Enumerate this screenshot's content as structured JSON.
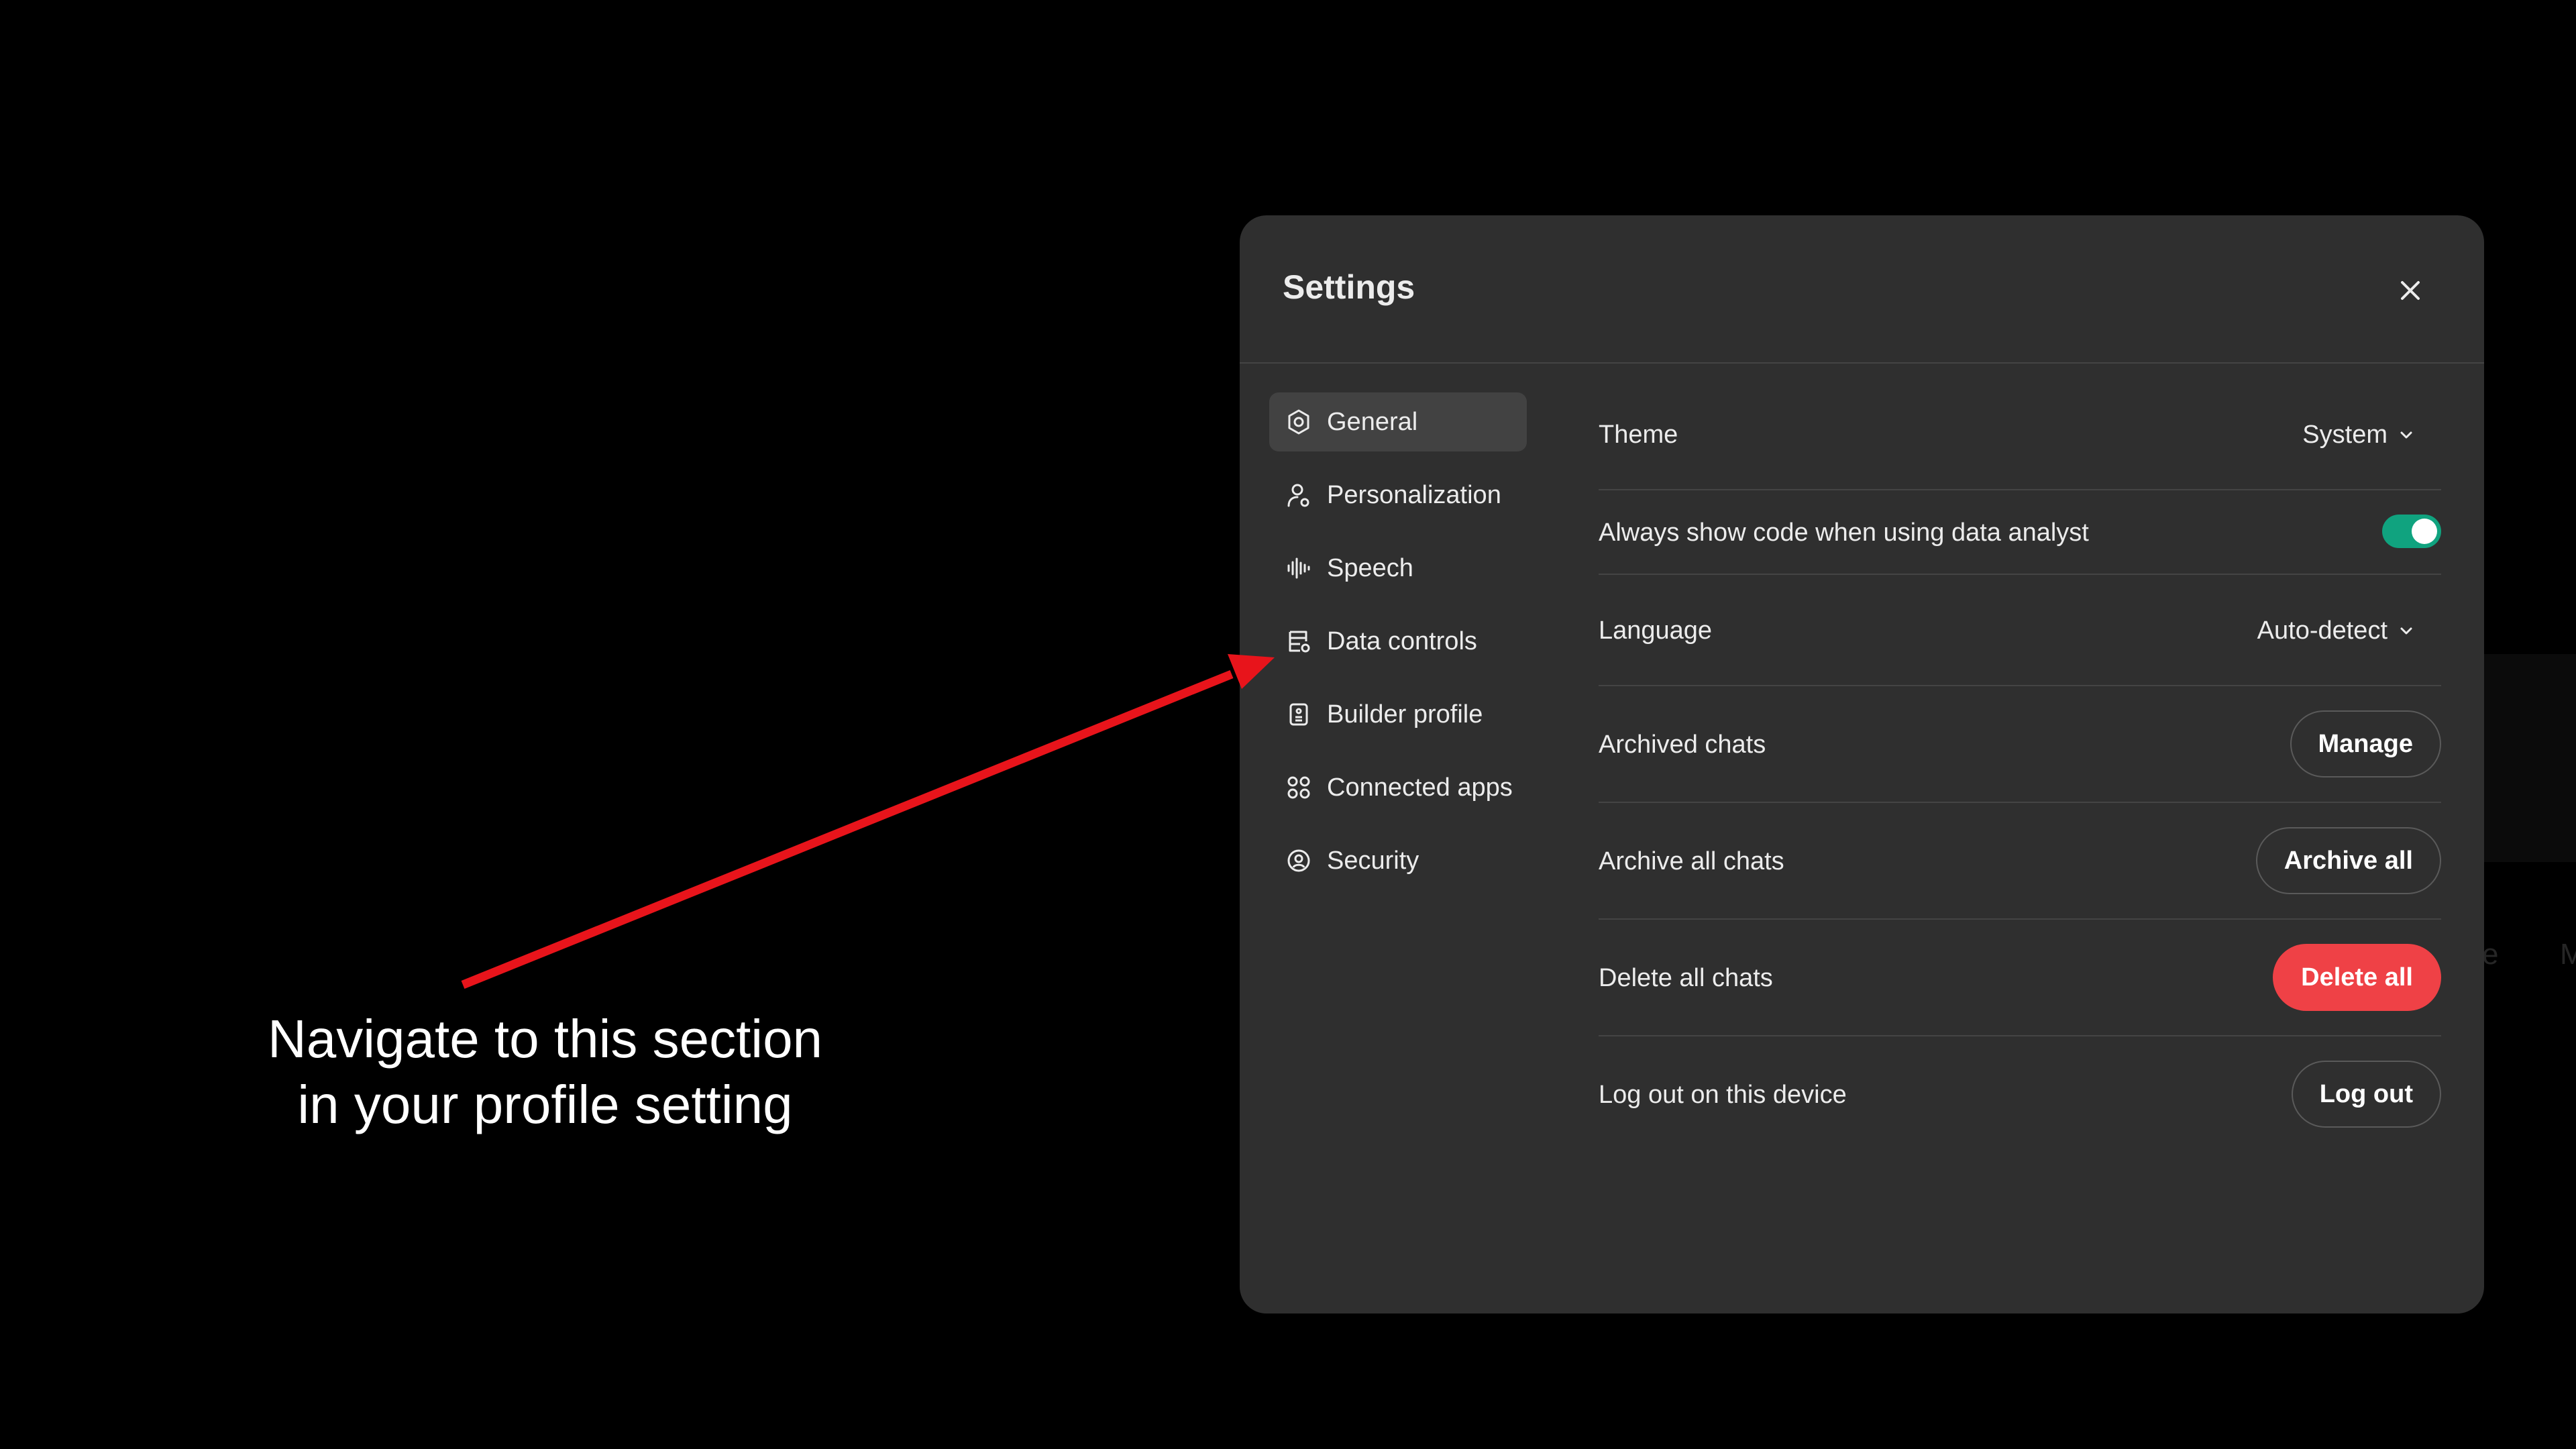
{
  "annotation": {
    "caption_line1": "Navigate to this section",
    "caption_line2": "in your profile setting",
    "arrow_color": "#e8141b"
  },
  "settings": {
    "title": "Settings",
    "close_icon": "close-icon",
    "sidebar": {
      "items": [
        {
          "label": "General",
          "icon": "gear-icon",
          "active": true
        },
        {
          "label": "Personalization",
          "icon": "person-icon",
          "active": false
        },
        {
          "label": "Speech",
          "icon": "soundwave-icon",
          "active": false
        },
        {
          "label": "Data controls",
          "icon": "database-icon",
          "active": false
        },
        {
          "label": "Builder profile",
          "icon": "id-badge-icon",
          "active": false
        },
        {
          "label": "Connected apps",
          "icon": "apps-grid-icon",
          "active": false
        },
        {
          "label": "Security",
          "icon": "shield-icon",
          "active": false
        }
      ]
    },
    "general": {
      "theme": {
        "label": "Theme",
        "value": "System"
      },
      "show_code": {
        "label": "Always show code when using data analyst",
        "enabled": true
      },
      "language": {
        "label": "Language",
        "value": "Auto-detect"
      },
      "archived_chats": {
        "label": "Archived chats",
        "button": "Manage"
      },
      "archive_all": {
        "label": "Archive all chats",
        "button": "Archive all"
      },
      "delete_all": {
        "label": "Delete all chats",
        "button": "Delete all"
      },
      "log_out": {
        "label": "Log out on this device",
        "button": "Log out"
      }
    }
  },
  "colors": {
    "page_bg": "#000000",
    "modal_bg": "#2f2f2f",
    "active_nav_bg": "#424242",
    "toggle_on": "#10a37f",
    "danger": "#ef4146"
  }
}
